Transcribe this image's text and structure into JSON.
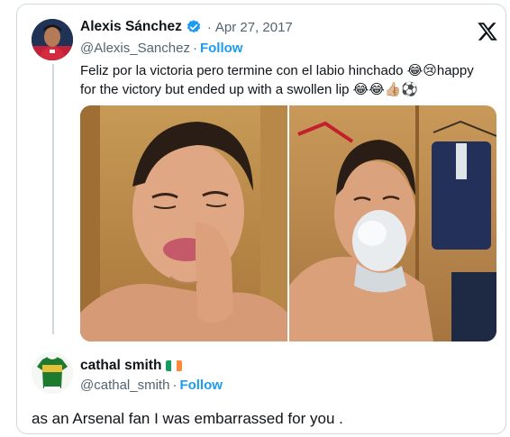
{
  "tweet": {
    "display_name": "Alexis Sánchez",
    "date": "Apr 27, 2017",
    "handle": "@Alexis_Sanchez",
    "follow_label": "Follow",
    "separator": "·",
    "text_line1": "Feliz por la victoria pero termine con el labio hinchado 😂😢happy",
    "text_line2": "for the victory but ended up with a swollen lip 😂😂👍🏼⚽",
    "verified": true,
    "photos": [
      {
        "icon": "injured-lip-photo"
      },
      {
        "icon": "ice-pack-photo"
      }
    ]
  },
  "reply": {
    "display_name": "cathal smith",
    "flag": "ireland-flag",
    "handle": "@cathal_smith",
    "follow_label": "Follow",
    "separator": "·",
    "text": "as an Arsenal fan I was embarrassed for you ."
  },
  "colors": {
    "link": "#1d9bf0",
    "secondary": "#536471",
    "primary": "#0f1419",
    "border": "#cfd9de"
  }
}
